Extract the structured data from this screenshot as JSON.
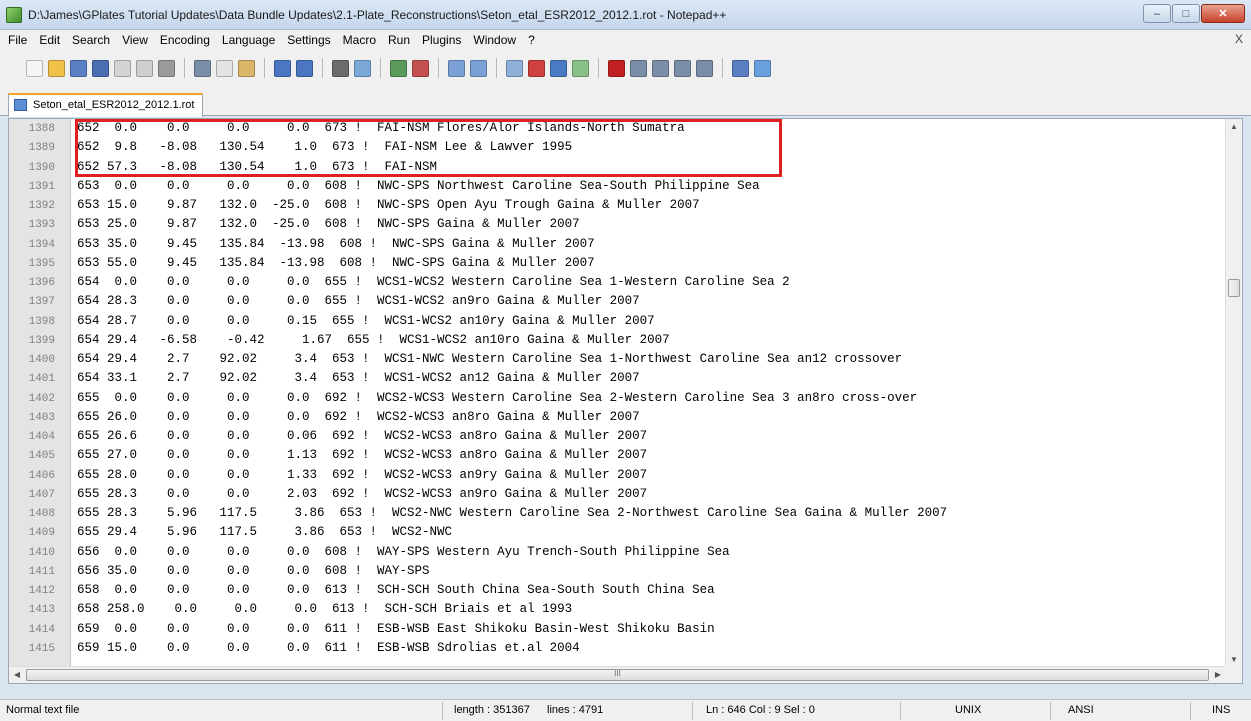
{
  "window": {
    "title": "D:\\James\\GPlates Tutorial Updates\\Data Bundle Updates\\2.1-Plate_Reconstructions\\Seton_etal_ESR2012_2012.1.rot - Notepad++",
    "minimize": "–",
    "maximize": "□",
    "close": "✕"
  },
  "menu": {
    "items": [
      "File",
      "Edit",
      "Search",
      "View",
      "Encoding",
      "Language",
      "Settings",
      "Macro",
      "Run",
      "Plugins",
      "Window",
      "?"
    ],
    "close": "X"
  },
  "toolbar": {
    "icons": [
      {
        "name": "new-file-icon",
        "color": "#f5f5f5"
      },
      {
        "name": "open-file-icon",
        "color": "#f0c24a"
      },
      {
        "name": "save-icon",
        "color": "#5b7fc4"
      },
      {
        "name": "save-all-icon",
        "color": "#4a6db3"
      },
      {
        "name": "close-icon",
        "color": "#d4d4d4"
      },
      {
        "name": "close-all-icon",
        "color": "#cfcfcf"
      },
      {
        "name": "print-icon",
        "color": "#9a9a9a"
      },
      {
        "name": "sep"
      },
      {
        "name": "cut-icon",
        "color": "#7a8ea8"
      },
      {
        "name": "copy-icon",
        "color": "#e3e3e3"
      },
      {
        "name": "paste-icon",
        "color": "#d9b66a"
      },
      {
        "name": "sep"
      },
      {
        "name": "undo-icon",
        "color": "#4a76c2"
      },
      {
        "name": "redo-icon",
        "color": "#4a76c2"
      },
      {
        "name": "sep"
      },
      {
        "name": "find-icon",
        "color": "#6b6b6b"
      },
      {
        "name": "replace-icon",
        "color": "#7aa9d8"
      },
      {
        "name": "sep"
      },
      {
        "name": "zoom-in-icon",
        "color": "#5a9a5a"
      },
      {
        "name": "zoom-out-icon",
        "color": "#c45050"
      },
      {
        "name": "sep"
      },
      {
        "name": "sync-vertical-icon",
        "color": "#7ba0d6"
      },
      {
        "name": "sync-horizontal-icon",
        "color": "#7ba0d6"
      },
      {
        "name": "sep"
      },
      {
        "name": "word-wrap-icon",
        "color": "#8fb0d8"
      },
      {
        "name": "show-all-chars-icon",
        "color": "#d04040"
      },
      {
        "name": "indent-guide-icon",
        "color": "#4a7ac4"
      },
      {
        "name": "user-language-icon",
        "color": "#88c088"
      },
      {
        "name": "sep"
      },
      {
        "name": "record-macro-icon",
        "color": "#c02020"
      },
      {
        "name": "stop-macro-icon",
        "color": "#7a8ea8"
      },
      {
        "name": "play-macro-icon",
        "color": "#7a8ea8"
      },
      {
        "name": "run-macro-multiple-icon",
        "color": "#7a8ea8"
      },
      {
        "name": "save-macro-icon",
        "color": "#7a8ea8"
      },
      {
        "name": "sep"
      },
      {
        "name": "trim-icon",
        "color": "#5b7fc4"
      },
      {
        "name": "spellcheck-icon",
        "color": "#6aa0e0"
      }
    ]
  },
  "tab": {
    "label": "Seton_etal_ESR2012_2012.1.rot"
  },
  "editor": {
    "lines": [
      {
        "n": "1388",
        "text": "652  0.0    0.0     0.0     0.0  673 !  FAI-NSM Flores/Alor Islands-North Sumatra"
      },
      {
        "n": "1389",
        "text": "652  9.8   -8.08   130.54    1.0  673 !  FAI-NSM Lee & Lawver 1995"
      },
      {
        "n": "1390",
        "text": "652 57.3   -8.08   130.54    1.0  673 !  FAI-NSM"
      },
      {
        "n": "1391",
        "text": "653  0.0    0.0     0.0     0.0  608 !  NWC-SPS Northwest Caroline Sea-South Philippine Sea"
      },
      {
        "n": "1392",
        "text": "653 15.0    9.87   132.0  -25.0  608 !  NWC-SPS Open Ayu Trough Gaina & Muller 2007"
      },
      {
        "n": "1393",
        "text": "653 25.0    9.87   132.0  -25.0  608 !  NWC-SPS Gaina & Muller 2007"
      },
      {
        "n": "1394",
        "text": "653 35.0    9.45   135.84  -13.98  608 !  NWC-SPS Gaina & Muller 2007"
      },
      {
        "n": "1395",
        "text": "653 55.0    9.45   135.84  -13.98  608 !  NWC-SPS Gaina & Muller 2007"
      },
      {
        "n": "1396",
        "text": "654  0.0    0.0     0.0     0.0  655 !  WCS1-WCS2 Western Caroline Sea 1-Western Caroline Sea 2"
      },
      {
        "n": "1397",
        "text": "654 28.3    0.0     0.0     0.0  655 !  WCS1-WCS2 an9ro Gaina & Muller 2007"
      },
      {
        "n": "1398",
        "text": "654 28.7    0.0     0.0     0.15  655 !  WCS1-WCS2 an10ry Gaina & Muller 2007"
      },
      {
        "n": "1399",
        "text": "654 29.4   -6.58    -0.42     1.67  655 !  WCS1-WCS2 an10ro Gaina & Muller 2007"
      },
      {
        "n": "1400",
        "text": "654 29.4    2.7    92.02     3.4  653 !  WCS1-NWC Western Caroline Sea 1-Northwest Caroline Sea an12 crossover"
      },
      {
        "n": "1401",
        "text": "654 33.1    2.7    92.02     3.4  653 !  WCS1-WCS2 an12 Gaina & Muller 2007"
      },
      {
        "n": "1402",
        "text": "655  0.0    0.0     0.0     0.0  692 !  WCS2-WCS3 Western Caroline Sea 2-Western Caroline Sea 3 an8ro cross-over"
      },
      {
        "n": "1403",
        "text": "655 26.0    0.0     0.0     0.0  692 !  WCS2-WCS3 an8ro Gaina & Muller 2007"
      },
      {
        "n": "1404",
        "text": "655 26.6    0.0     0.0     0.06  692 !  WCS2-WCS3 an8ro Gaina & Muller 2007"
      },
      {
        "n": "1405",
        "text": "655 27.0    0.0     0.0     1.13  692 !  WCS2-WCS3 an8ro Gaina & Muller 2007"
      },
      {
        "n": "1406",
        "text": "655 28.0    0.0     0.0     1.33  692 !  WCS2-WCS3 an9ry Gaina & Muller 2007"
      },
      {
        "n": "1407",
        "text": "655 28.3    0.0     0.0     2.03  692 !  WCS2-WCS3 an9ro Gaina & Muller 2007"
      },
      {
        "n": "1408",
        "text": "655 28.3    5.96   117.5     3.86  653 !  WCS2-NWC Western Caroline Sea 2-Northwest Caroline Sea Gaina & Muller 2007"
      },
      {
        "n": "1409",
        "text": "655 29.4    5.96   117.5     3.86  653 !  WCS2-NWC"
      },
      {
        "n": "1410",
        "text": "656  0.0    0.0     0.0     0.0  608 !  WAY-SPS Western Ayu Trench-South Philippine Sea"
      },
      {
        "n": "1411",
        "text": "656 35.0    0.0     0.0     0.0  608 !  WAY-SPS"
      },
      {
        "n": "1412",
        "text": "658  0.0    0.0     0.0     0.0  613 !  SCH-SCH South China Sea-South South China Sea"
      },
      {
        "n": "1413",
        "text": "658 258.0    0.0     0.0     0.0  613 !  SCH-SCH Briais et al 1993"
      },
      {
        "n": "1414",
        "text": "659  0.0    0.0     0.0     0.0  611 !  ESB-WSB East Shikoku Basin-West Shikoku Basin"
      },
      {
        "n": "1415",
        "text": "659 15.0    0.0     0.0     0.0  611 !  ESB-WSB Sdrolias et.al 2004"
      }
    ],
    "hscroll_grip": "III"
  },
  "status": {
    "file_type": "Normal text file",
    "length": "length : 351367",
    "lines": "lines : 4791",
    "position": "Ln : 646   Col : 9   Sel : 0",
    "eol": "UNIX",
    "encoding": "ANSI",
    "mode": "INS"
  }
}
